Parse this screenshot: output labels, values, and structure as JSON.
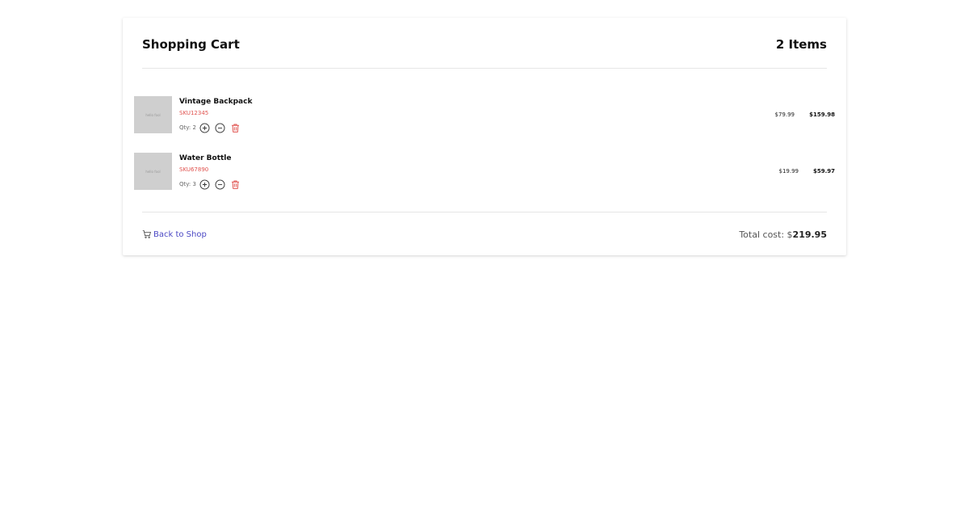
{
  "cart": {
    "title": "Shopping Cart",
    "item_count": "2 Items",
    "items": [
      {
        "thumb_text": "hello fool",
        "name": "Vintage Backpack",
        "sku": "SKU12345",
        "qty_label": "Qty: 2",
        "unit_price": "$79.99",
        "line_total": "$159.98"
      },
      {
        "thumb_text": "hello fool",
        "name": "Water Bottle",
        "sku": "SKU67890",
        "qty_label": "Qty: 3",
        "unit_price": "$19.99",
        "line_total": "$59.97"
      }
    ],
    "back_label": "Back to Shop",
    "total_label": "Total cost: $",
    "total_value": "219.95"
  },
  "icons": {
    "back": "cart-icon",
    "plus": "plus-circle-icon",
    "minus": "minus-circle-icon",
    "delete": "trash-icon"
  },
  "colors": {
    "sku": "#e0524e",
    "link": "#4b48c4",
    "delete": "#e0524e",
    "thumb": "#cfcfcf"
  }
}
